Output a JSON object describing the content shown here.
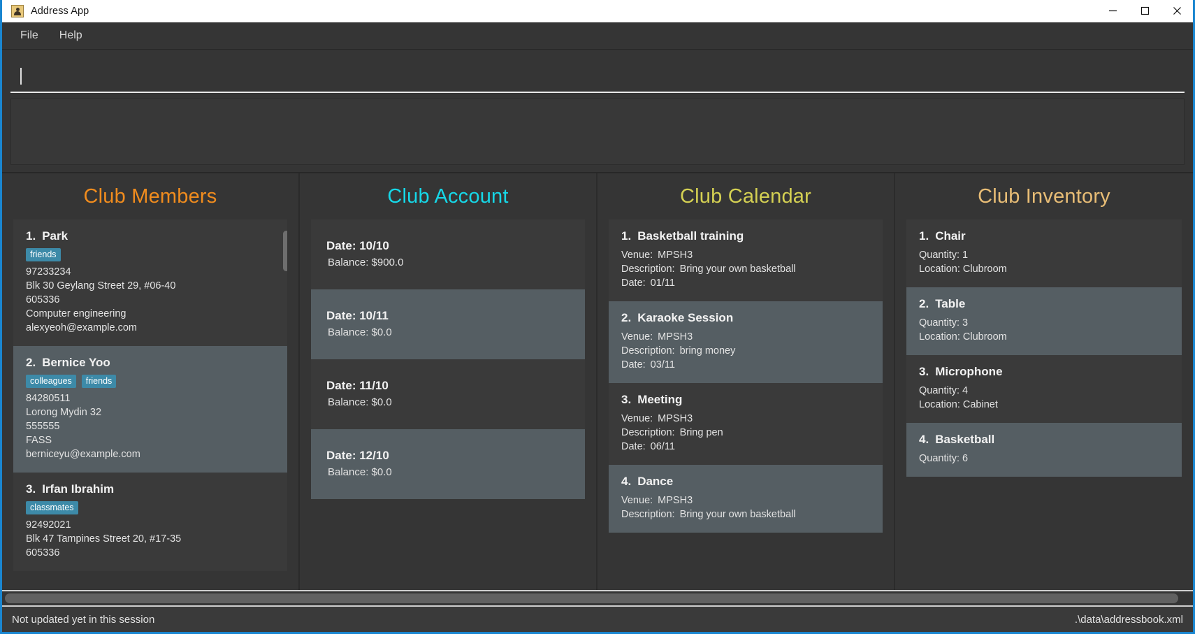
{
  "window": {
    "title": "Address App",
    "icon": "person-card-icon",
    "controls": {
      "minimize": "minimize-icon",
      "maximize": "maximize-icon",
      "close": "close-icon"
    }
  },
  "menu": {
    "items": [
      {
        "label": "File"
      },
      {
        "label": "Help"
      }
    ]
  },
  "command_box": {
    "value": "",
    "placeholder": ""
  },
  "result_display": {
    "text": ""
  },
  "panels": [
    {
      "title": "Club Members",
      "title_color": "#f08c1e",
      "scrollbar": {
        "side": "right",
        "top_pct": 3,
        "height_pct": 11
      },
      "cards": [
        {
          "index": "1.",
          "name": "Park",
          "tags": [
            "friends"
          ],
          "lines": [
            "97233234",
            "Blk 30 Geylang Street 29, #06-40",
            "605336",
            "Computer engineering",
            "alexyeoh@example.com"
          ]
        },
        {
          "index": "2.",
          "name": "Bernice Yoo",
          "tags": [
            "colleagues",
            "friends"
          ],
          "lines": [
            "84280511",
            "Lorong Mydin 32",
            "555555",
            "FASS",
            "berniceyu@example.com"
          ]
        },
        {
          "index": "3.",
          "name": "Irfan Ibrahim",
          "tags": [
            "classmates"
          ],
          "lines": [
            "92492021",
            "Blk 47 Tampines Street 20, #17-35",
            "605336"
          ]
        }
      ]
    },
    {
      "title": "Club Account",
      "title_color": "#16d8e8",
      "scrollbar": {
        "side": "left",
        "top_pct": 1,
        "height_pct": 14
      },
      "accounts": [
        {
          "date_label": "Date: 10/10",
          "balance_label": "Balance: $900.0"
        },
        {
          "date_label": "Date: 10/11",
          "balance_label": "Balance: $0.0"
        },
        {
          "date_label": "Date: 11/10",
          "balance_label": "Balance: $0.0"
        },
        {
          "date_label": "Date: 12/10",
          "balance_label": "Balance: $0.0"
        }
      ]
    },
    {
      "title": "Club Calendar",
      "title_color": "#d4d053",
      "scrollbar": {
        "side": "left",
        "top_pct": 2,
        "height_pct": 25
      },
      "events": [
        {
          "index": "1.",
          "name": "Basketball training",
          "venue_label": "Venue:",
          "venue": "MPSH3",
          "description_label": "Description:",
          "description": "Bring your own basketball",
          "date_label": "Date:",
          "date": "01/11"
        },
        {
          "index": "2.",
          "name": "Karaoke Session",
          "venue_label": "Venue:",
          "venue": "MPSH3",
          "description_label": "Description:",
          "description": "bring money",
          "date_label": "Date:",
          "date": "03/11"
        },
        {
          "index": "3.",
          "name": "Meeting",
          "venue_label": "Venue:",
          "venue": "MPSH3",
          "description_label": "Description:",
          "description": "Bring pen",
          "date_label": "Date:",
          "date": "06/11"
        },
        {
          "index": "4.",
          "name": "Dance",
          "venue_label": "Venue:",
          "venue": "MPSH3",
          "description_label": "Description:",
          "description": "Bring your own basketball",
          "date_label": "Date:",
          "date": ""
        }
      ]
    },
    {
      "title": "Club Inventory",
      "title_color": "#e8bd76",
      "scrollbar": {
        "side": "left",
        "top_pct": 2,
        "height_pct": 22
      },
      "items": [
        {
          "index": "1.",
          "name": "Chair",
          "quantity_label": "Quantity: 1",
          "location_label": "Location: Clubroom"
        },
        {
          "index": "2.",
          "name": "Table",
          "quantity_label": "Quantity: 3",
          "location_label": "Location: Clubroom"
        },
        {
          "index": "3.",
          "name": "Microphone",
          "quantity_label": "Quantity: 4",
          "location_label": "Location: Cabinet"
        },
        {
          "index": "4.",
          "name": "Basketball",
          "quantity_label": "Quantity: 6",
          "location_label": ""
        }
      ]
    }
  ],
  "status_bar": {
    "sync_status": "Not updated yet in this session",
    "save_location": ".\\data\\addressbook.xml"
  }
}
